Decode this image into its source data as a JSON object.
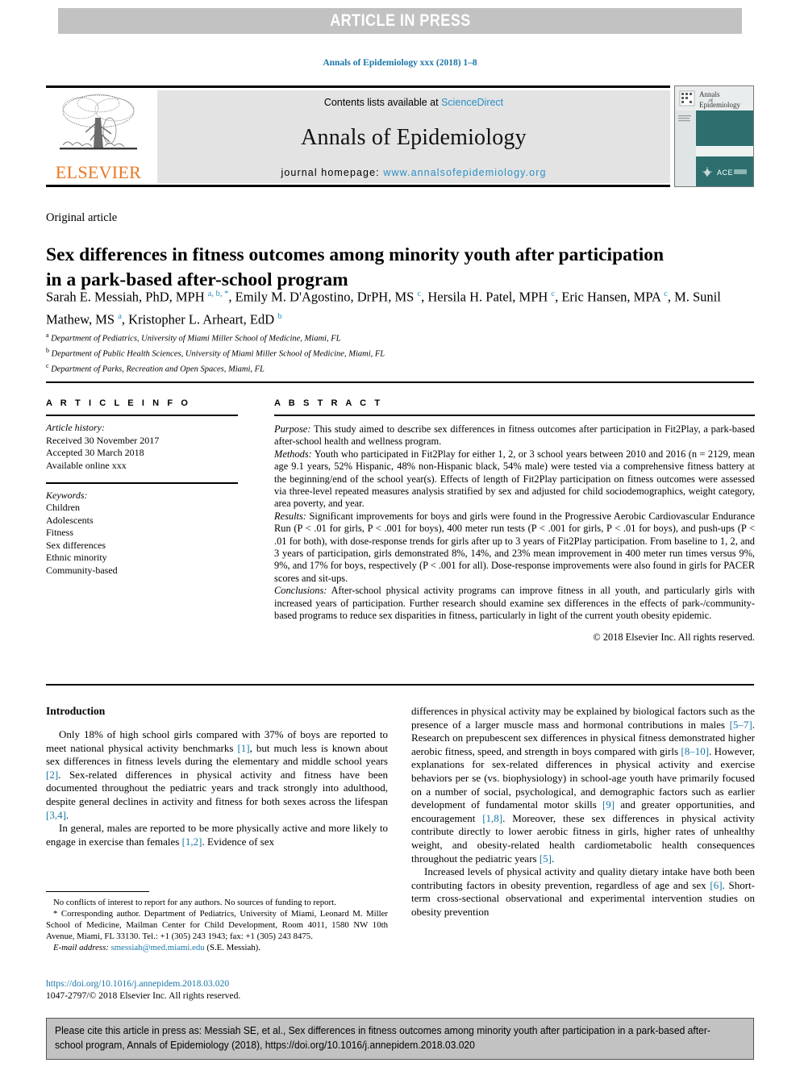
{
  "banner": {
    "text": "ARTICLE IN PRESS"
  },
  "running_head": "Annals of Epidemiology xxx (2018) 1–8",
  "masthead": {
    "publisher": "ELSEVIER",
    "contents_prefix": "Contents lists available at ",
    "contents_link": "ScienceDirect",
    "journal_title": "Annals of Epidemiology",
    "homepage_prefix": "journal homepage: ",
    "homepage_link": "www.annalsofepidemiology.org",
    "cover_title_line1": "Annals",
    "cover_title_line2": "of",
    "cover_title_line3": "Epidemiology",
    "cover_logo_text": "ACE",
    "accent_orange": "#e87722",
    "accent_link_blue": "#2a8fc4",
    "cover_teal": "#2d6f6f"
  },
  "article": {
    "type_label": "Original article",
    "title": "Sex differences in fitness outcomes among minority youth after participation in a park-based after-school program",
    "authors_html": "Sarah E. Messiah, PhD, MPH <sup>a, b, *</sup>, Emily M. D'Agostino, DrPH, MS <sup>c</sup>, Hersila H. Patel, MPH <sup>c</sup>, Eric Hansen, MPA <sup>c</sup>, M. Sunil Mathew, MS <sup>a</sup>, Kristopher L. Arheart, EdD <sup>b</sup>",
    "affiliations": [
      {
        "marker": "a",
        "text": "Department of Pediatrics, University of Miami Miller School of Medicine, Miami, FL"
      },
      {
        "marker": "b",
        "text": "Department of Public Health Sciences, University of Miami Miller School of Medicine, Miami, FL"
      },
      {
        "marker": "c",
        "text": "Department of Parks, Recreation and Open Spaces, Miami, FL"
      }
    ]
  },
  "article_info": {
    "heading": "A R T I C L E   I N F O",
    "history_label": "Article history:",
    "history": [
      "Received 30 November 2017",
      "Accepted 30 March 2018",
      "Available online xxx"
    ],
    "keywords_label": "Keywords:",
    "keywords": [
      "Children",
      "Adolescents",
      "Fitness",
      "Sex differences",
      "Ethnic minority",
      "Community-based"
    ]
  },
  "abstract": {
    "heading": "A B S T R A C T",
    "sections": [
      {
        "label": "Purpose:",
        "text": " This study aimed to describe sex differences in fitness outcomes after participation in Fit2Play, a park-based after-school health and wellness program."
      },
      {
        "label": "Methods:",
        "text": " Youth who participated in Fit2Play for either 1, 2, or 3 school years between 2010 and 2016 (n = 2129, mean age 9.1 years, 52% Hispanic, 48% non-Hispanic black, 54% male) were tested via a comprehensive fitness battery at the beginning/end of the school year(s). Effects of length of Fit2Play participation on fitness outcomes were assessed via three-level repeated measures analysis stratified by sex and adjusted for child sociodemographics, weight category, area poverty, and year."
      },
      {
        "label": "Results:",
        "text": " Significant improvements for boys and girls were found in the Progressive Aerobic Cardiovascular Endurance Run (P < .01 for girls, P < .001 for boys), 400 meter run tests (P < .001 for girls, P < .01 for boys), and push-ups (P < .01 for both), with dose-response trends for girls after up to 3 years of Fit2Play participation. From baseline to 1, 2, and 3 years of participation, girls demonstrated 8%, 14%, and 23% mean improvement in 400 meter run times versus 9%, 9%, and 17% for boys, respectively (P < .001 for all). Dose-response improvements were also found in girls for PACER scores and sit-ups."
      },
      {
        "label": "Conclusions:",
        "text": " After-school physical activity programs can improve fitness in all youth, and particularly girls with increased years of participation. Further research should examine sex differences in the effects of park-/community-based programs to reduce sex disparities in fitness, particularly in light of the current youth obesity epidemic."
      }
    ],
    "copyright": "© 2018 Elsevier Inc. All rights reserved."
  },
  "body": {
    "section_heading": "Introduction",
    "left_paragraphs": [
      "Only 18% of high school girls compared with 37% of boys are reported to meet national physical activity benchmarks [1], but much less is known about sex differences in fitness levels during the elementary and middle school years [2]. Sex-related differences in physical activity and fitness have been documented throughout the pediatric years and track strongly into adulthood, despite general declines in activity and fitness for both sexes across the lifespan [3,4].",
      "In general, males are reported to be more physically active and more likely to engage in exercise than females [1,2]. Evidence of sex"
    ],
    "right_paragraphs": [
      "differences in physical activity may be explained by biological factors such as the presence of a larger muscle mass and hormonal contributions in males [5–7]. Research on prepubescent sex differences in physical fitness demonstrated higher aerobic fitness, speed, and strength in boys compared with girls [8–10]. However, explanations for sex-related differences in physical activity and exercise behaviors per se (vs. biophysiology) in school-age youth have primarily focused on a number of social, psychological, and demographic factors such as earlier development of fundamental motor skills [9] and greater opportunities, and encouragement [1,8]. Moreover, these sex differences in physical activity contribute directly to lower aerobic fitness in girls, higher rates of unhealthy weight, and obesity-related health cardiometabolic health consequences throughout the pediatric years [5].",
      "Increased levels of physical activity and quality dietary intake have both been contributing factors in obesity prevention, regardless of age and sex [6]. Short-term cross-sectional observational and experimental intervention studies on obesity prevention"
    ]
  },
  "footnotes": {
    "conflicts": "No conflicts of interest to report for any authors. No sources of funding to report.",
    "corresponding": "* Corresponding author. Department of Pediatrics, University of Miami, Leonard M. Miller School of Medicine, Mailman Center for Child Development, Room 4011, 1580 NW 10th Avenue, Miami, FL 33130. Tel.: +1 (305) 243 1943; fax: +1 (305) 243 8475.",
    "email_label": "E-mail address:",
    "email": "smessiah@med.miami.edu",
    "email_suffix": "(S.E. Messiah).",
    "doi": "https://doi.org/10.1016/j.annepidem.2018.03.020",
    "issn_line": "1047-2797/© 2018 Elsevier Inc. All rights reserved."
  },
  "cite_box": {
    "text": "Please cite this article in press as: Messiah SE, et al., Sex differences in fitness outcomes among minority youth after participation in a park-based after-school program, Annals of Epidemiology (2018), https://doi.org/10.1016/j.annepidem.2018.03.020"
  }
}
